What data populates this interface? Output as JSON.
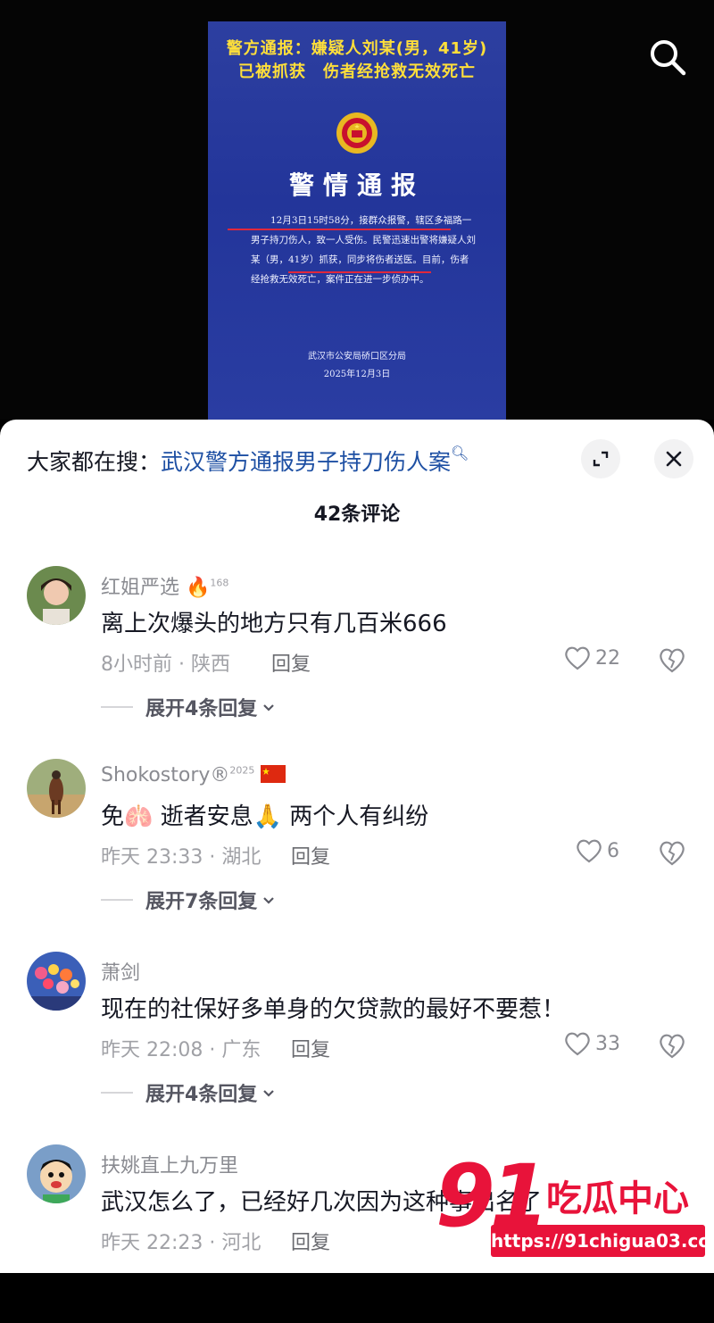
{
  "video": {
    "headline_line1": "警方通报：嫌疑人刘某(男，41岁)",
    "headline_line2": "已被抓获　伤者经抢救无效死亡",
    "notice_title": "警情通报",
    "notice_body": "12月3日15时58分，接群众报警，辖区多福路一男子持刀伤人，致一人受伤。民警迅速出警将嫌疑人刘某（男，41岁）抓获，同步将伤者送医。目前，伤者经抢救无效死亡，案件正在进一步侦办中。",
    "issuer": "武汉市公安局硚口区分局",
    "date": "2025年12月3日"
  },
  "suggest": {
    "prefix": "大家都在搜：",
    "keyword": "武汉警方通报男子持刀伤人案"
  },
  "comment_count": "42条评论",
  "reply_label": "回复",
  "comments": [
    {
      "name": "红姐严选",
      "badge": "168",
      "text": "离上次爆头的地方只有几百米666",
      "time_loc": "8小时前 · 陕西",
      "likes": "22",
      "expand": "展开4条回复"
    },
    {
      "name": "Shokostory®",
      "badge": "2025",
      "text": "免🫁 逝者安息🙏 两个人有纠纷",
      "time_loc": "昨天 23:33 · 湖北",
      "likes": "6",
      "expand": "展开7条回复"
    },
    {
      "name": "萧剑",
      "badge": "",
      "text": "现在的社保好多单身的欠贷款的最好不要惹！",
      "time_loc": "昨天 22:08 · 广东",
      "likes": "33",
      "expand": "展开4条回复"
    },
    {
      "name": "扶姚直上九万里",
      "badge": "",
      "text": "武汉怎么了，已经好几次因为这种事出名了",
      "time_loc": "昨天 22:23 · 河北",
      "likes": "",
      "expand": ""
    }
  ],
  "watermark": {
    "num": "91",
    "cn": "吃瓜中心",
    "url": "https://91chigua03.com"
  },
  "colors": {
    "poster_blue": "#2a3da2",
    "headline_yellow": "#ffdf3a",
    "keyword_blue": "#1d4fa3",
    "watermark_red": "#e8133a"
  },
  "icons": [
    "search-icon",
    "expand-icon",
    "close-icon",
    "heart-icon",
    "broken-heart-icon",
    "chevron-down-icon",
    "fire-icon",
    "china-flag-icon",
    "police-emblem-icon"
  ]
}
